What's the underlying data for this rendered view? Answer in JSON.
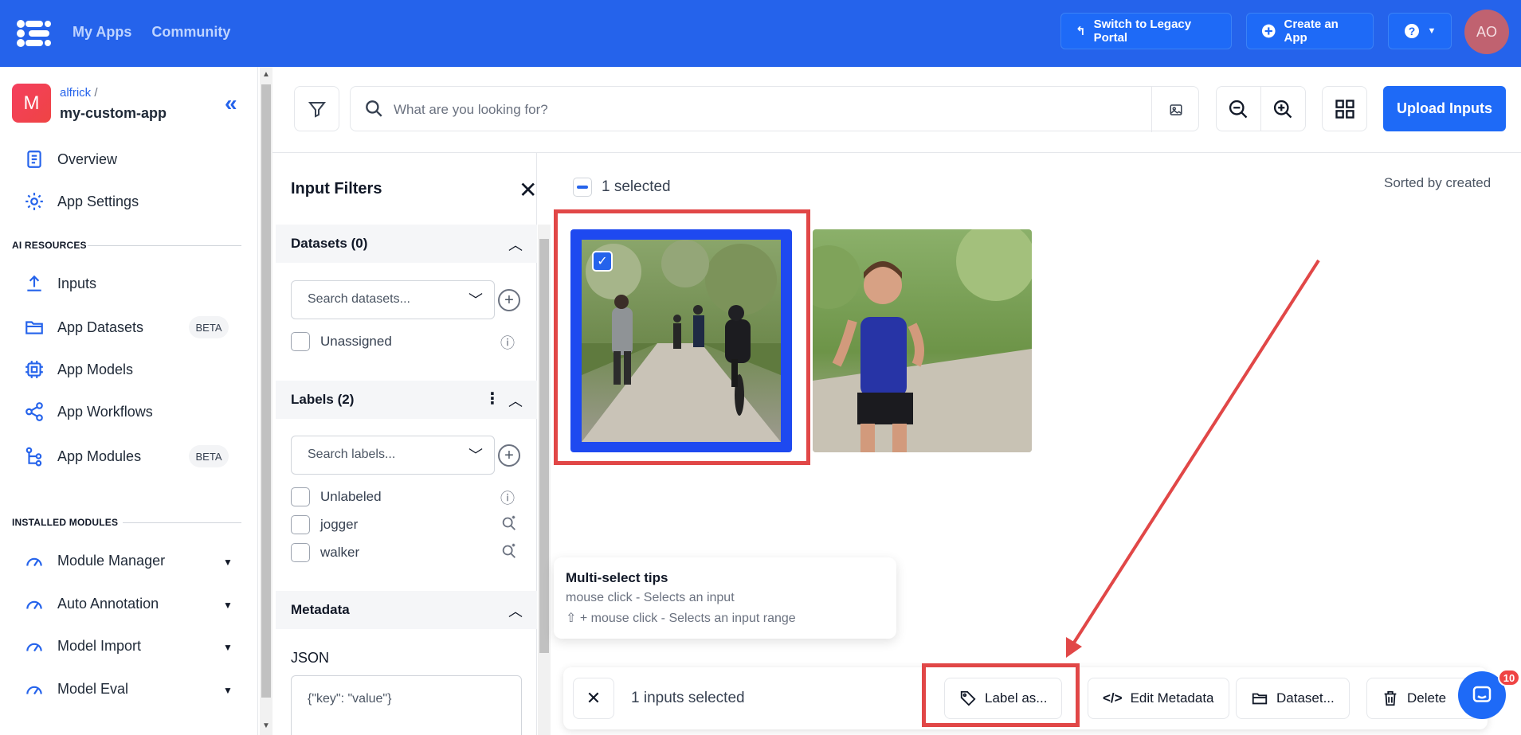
{
  "topbar": {
    "nav": [
      "My Apps",
      "Community"
    ],
    "legacy_label": "Switch to Legacy Portal",
    "create_label": "Create an App",
    "help_icon": "help-icon",
    "avatar_initials": "AO"
  },
  "sidebar": {
    "app_initial": "M",
    "owner": "alfrick",
    "owner_sep": "/",
    "app_name": "my-custom-app",
    "top_items": [
      {
        "label": "Overview",
        "icon": "document-icon"
      },
      {
        "label": "App Settings",
        "icon": "gear-icon"
      }
    ],
    "ai_resources_heading": "AI RESOURCES",
    "ai_items": [
      {
        "label": "Inputs",
        "icon": "upload-icon"
      },
      {
        "label": "App Datasets",
        "icon": "folder-icon",
        "badge": "BETA"
      },
      {
        "label": "App Models",
        "icon": "chip-icon"
      },
      {
        "label": "App Workflows",
        "icon": "share-icon"
      },
      {
        "label": "App Modules",
        "icon": "tree-icon",
        "badge": "BETA"
      }
    ],
    "installed_heading": "INSTALLED MODULES",
    "modules": [
      {
        "label": "Module Manager"
      },
      {
        "label": "Auto Annotation"
      },
      {
        "label": "Model Import"
      },
      {
        "label": "Model Eval"
      }
    ]
  },
  "toolbar": {
    "search_placeholder": "What are you looking for?",
    "upload_label": "Upload Inputs"
  },
  "filters": {
    "title": "Input Filters",
    "datasets_title": "Datasets (0)",
    "datasets_placeholder": "Search datasets...",
    "unassigned_label": "Unassigned",
    "labels_title": "Labels (2)",
    "labels_placeholder": "Search labels...",
    "label_options": [
      "Unlabeled",
      "jogger",
      "walker"
    ],
    "metadata_title": "Metadata",
    "json_label": "JSON",
    "json_placeholder": "{\"key\": \"value\"}"
  },
  "main": {
    "selected_text": "1 selected",
    "sorted_text": "Sorted by created"
  },
  "tips": {
    "heading": "Multi-select tips",
    "line1": "mouse click - Selects an input",
    "line2": "⇧ + mouse click - Selects an input range"
  },
  "actionbar": {
    "count_text": "1 inputs selected",
    "label_btn": "Label as...",
    "metadata_btn": "Edit Metadata",
    "dataset_btn": "Dataset...",
    "delete_btn": "Delete"
  },
  "chat": {
    "badge": "10"
  },
  "colors": {
    "primary": "#2563eb",
    "annotation": "#e14747"
  }
}
